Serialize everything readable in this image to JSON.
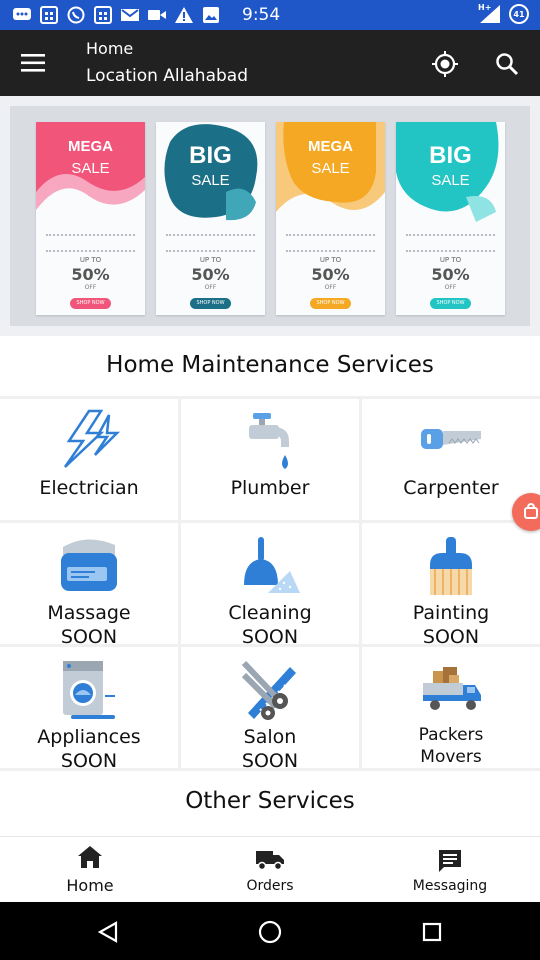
{
  "status_bar": {
    "time": "9:54",
    "network_label": "H+",
    "battery_level": "41",
    "icons": [
      "chat-icon",
      "calendar-icon",
      "whatsapp-icon",
      "calendar-icon",
      "gmail-icon",
      "video-icon",
      "warning-icon",
      "image-icon",
      "signal-icon",
      "battery-icon"
    ]
  },
  "toolbar": {
    "title": "Home",
    "subtitle": "Location Allahabad",
    "icons": [
      "menu-icon",
      "gps-location-icon",
      "search-icon"
    ]
  },
  "banner": {
    "cards": [
      {
        "line1": "MEGA",
        "line2": "SALE",
        "upto": "UP TO",
        "percent": "50%",
        "off": "OFF",
        "cta": "SHOP NOW",
        "color": "#f2557a"
      },
      {
        "line1": "BIG",
        "line2": "SALE",
        "upto": "UP TO",
        "percent": "50%",
        "off": "OFF",
        "cta": "SHOP NOW",
        "color": "#1b6f86"
      },
      {
        "line1": "MEGA",
        "line2": "SALE",
        "upto": "UP TO",
        "percent": "50%",
        "off": "OFF",
        "cta": "SHOP NOW",
        "color": "#f4a823"
      },
      {
        "line1": "BIG",
        "line2": "SALE",
        "upto": "UP TO",
        "percent": "50%",
        "off": "OFF",
        "cta": "SHOP NOW",
        "color": "#22c4c4"
      }
    ]
  },
  "home_maintenance": {
    "title": "Home Maintenance Services",
    "services": [
      {
        "label": "Electrician",
        "soon": "",
        "icon": "lightning-icon"
      },
      {
        "label": "Plumber",
        "soon": "",
        "icon": "tap-icon"
      },
      {
        "label": "Carpenter",
        "soon": "",
        "icon": "saw-icon"
      },
      {
        "label": "Massage",
        "soon": "SOON",
        "icon": "massage-icon"
      },
      {
        "label": "Cleaning",
        "soon": "SOON",
        "icon": "dustpan-icon"
      },
      {
        "label": "Painting",
        "soon": "SOON",
        "icon": "paint-brush-icon"
      },
      {
        "label": "Appliances",
        "soon": "SOON",
        "icon": "washing-machine-icon"
      },
      {
        "label": "Salon",
        "soon": "SOON",
        "icon": "scissors-comb-icon"
      },
      {
        "label": "Packers",
        "soon": "Movers",
        "icon": "truck-boxes-icon"
      }
    ]
  },
  "other_services": {
    "title": "Other  Services"
  },
  "bottom_nav": {
    "items": [
      {
        "label": "Home",
        "icon": "home-icon"
      },
      {
        "label": "Orders",
        "icon": "truck-icon"
      },
      {
        "label": "Messaging",
        "icon": "message-icon"
      }
    ]
  },
  "colors": {
    "status_bar": "#1f56c8",
    "toolbar": "#212121",
    "accent_blue": "#2f7fd6",
    "fab": "#f26b5b"
  }
}
